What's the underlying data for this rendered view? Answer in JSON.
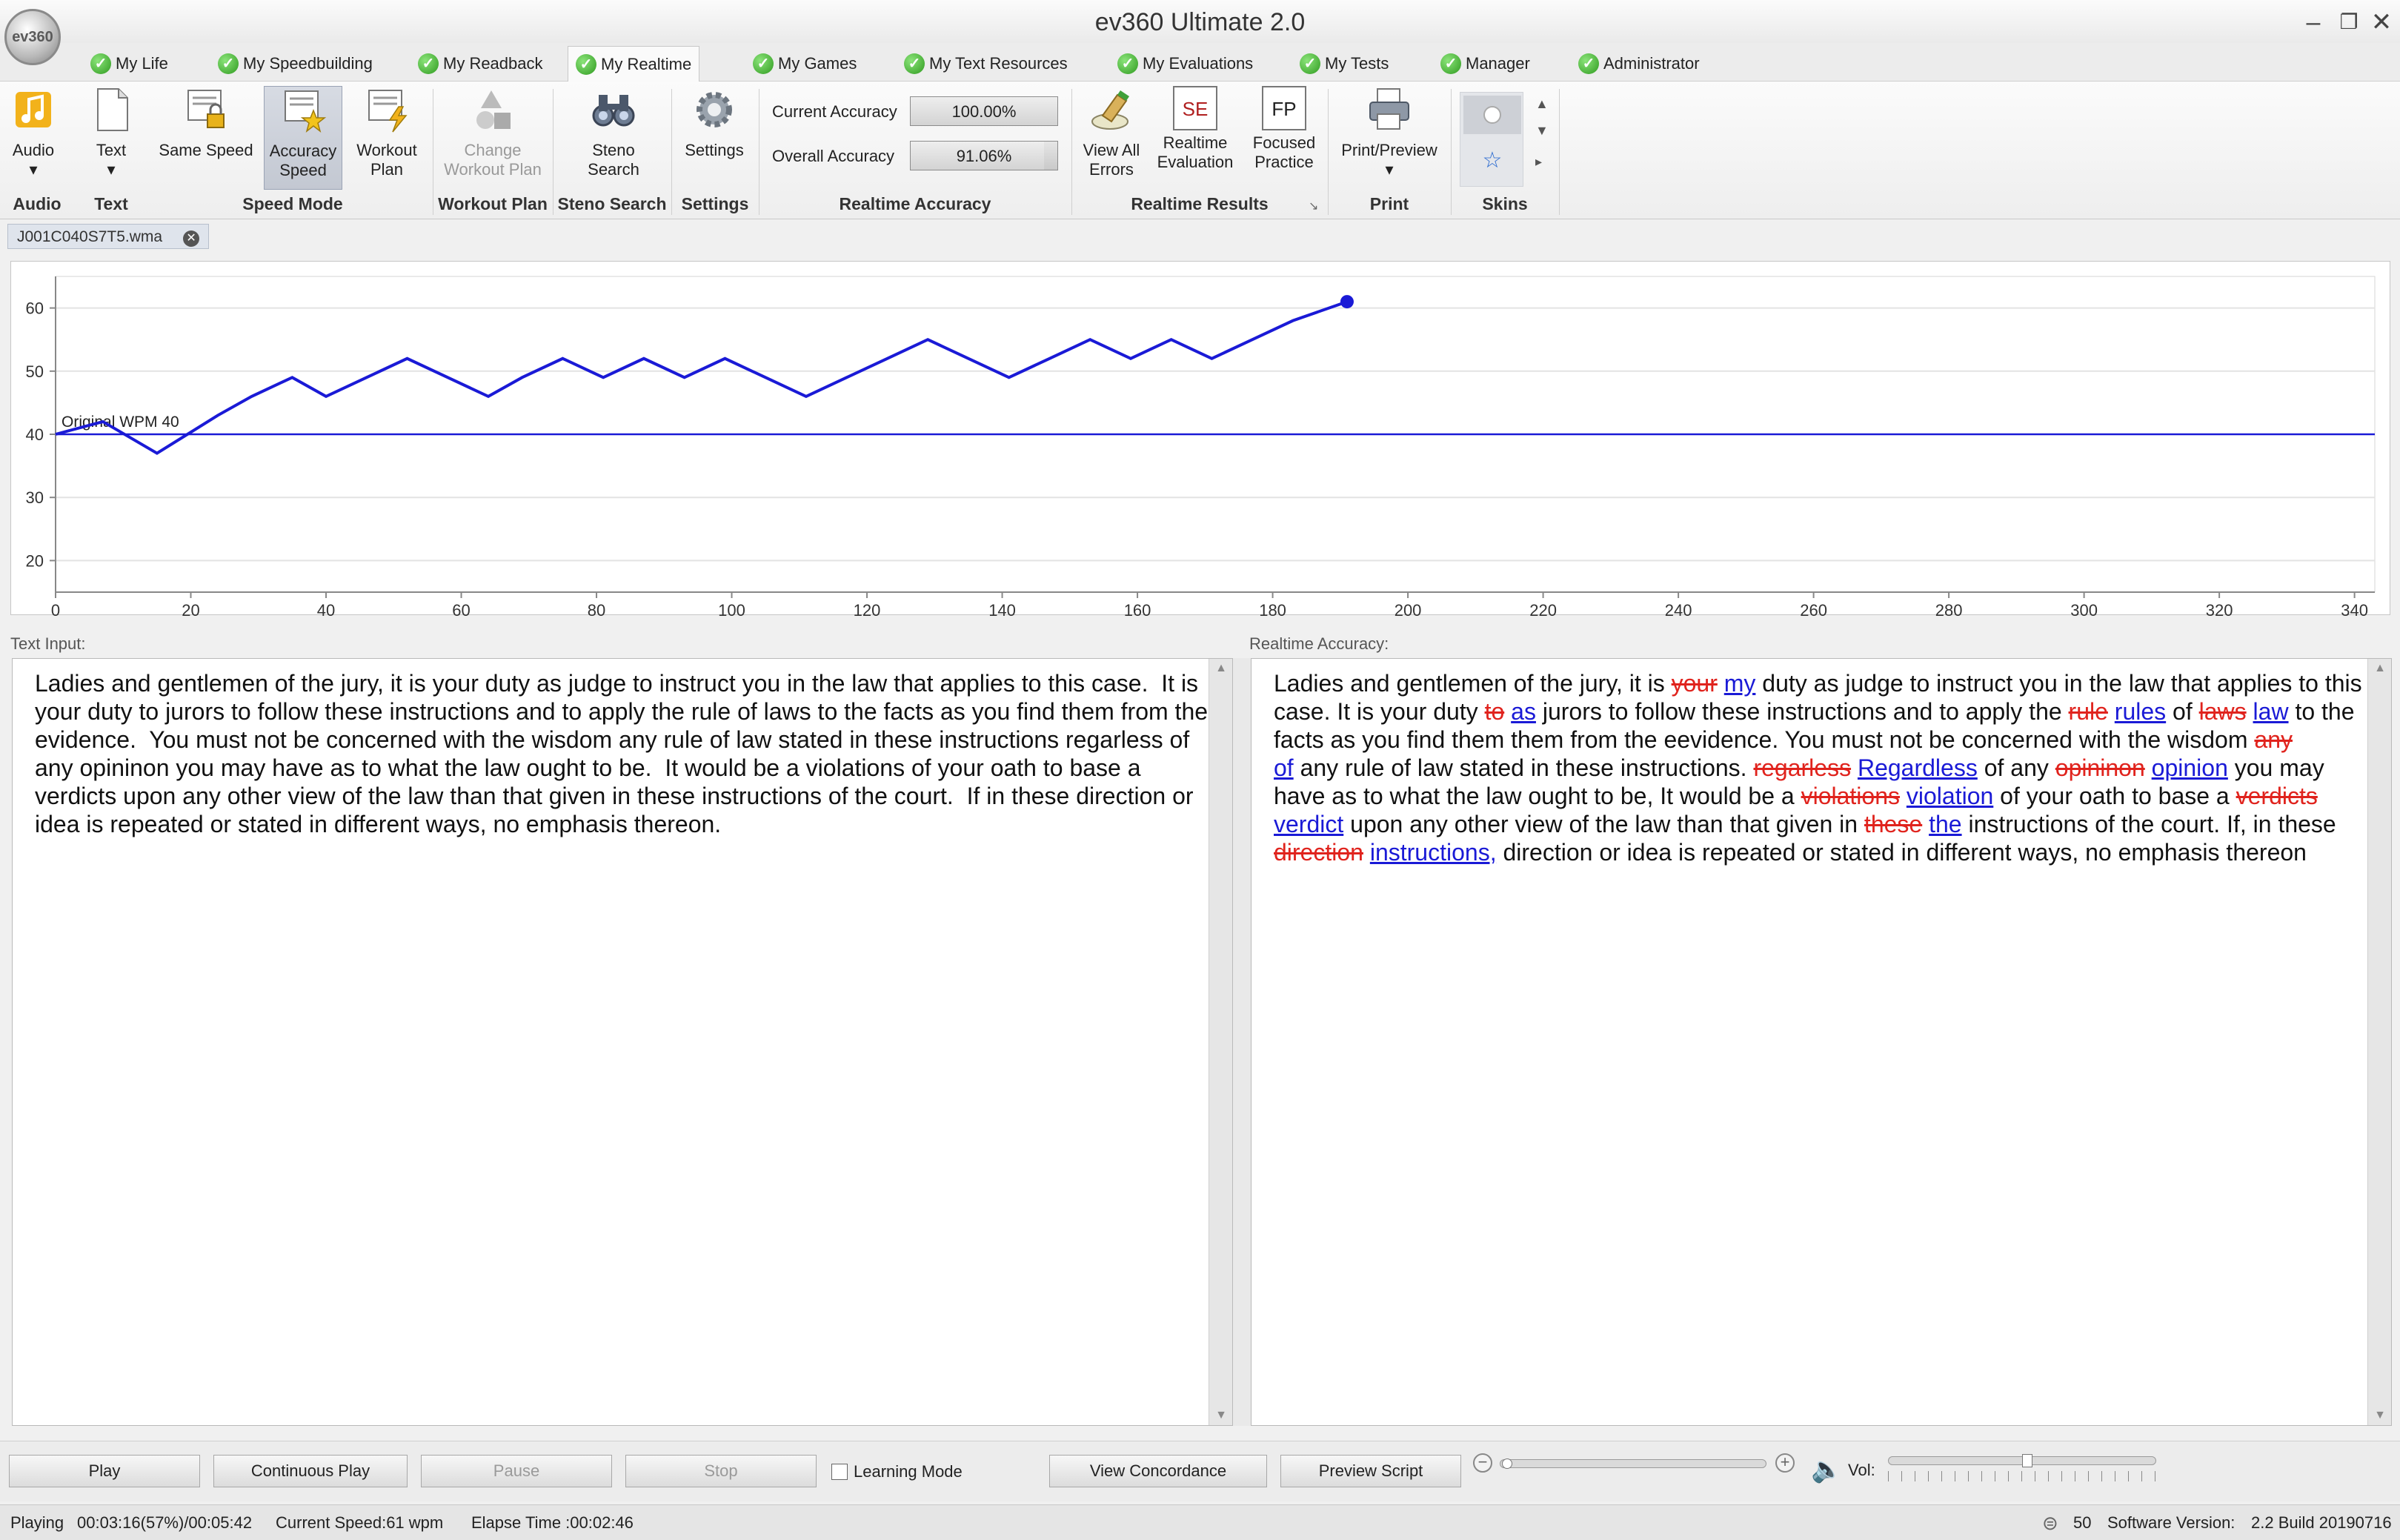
{
  "window": {
    "title": "ev360 Ultimate 2.0",
    "logo": "ev360"
  },
  "tabs": [
    {
      "label": "My Life"
    },
    {
      "label": "My Speedbuilding"
    },
    {
      "label": "My Readback"
    },
    {
      "label": "My Realtime"
    },
    {
      "label": "My Games"
    },
    {
      "label": "My Text Resources"
    },
    {
      "label": "My Evaluations"
    },
    {
      "label": "My Tests"
    },
    {
      "label": "Manager"
    },
    {
      "label": "Administrator"
    }
  ],
  "ribbon": {
    "audio": "Audio",
    "text": "Text",
    "same_speed": "Same Speed",
    "accuracy_speed_1": "Accuracy",
    "accuracy_speed_2": "Speed",
    "workout_plan_1": "Workout",
    "workout_plan_2": "Plan",
    "change_workout_1": "Change",
    "change_workout_2": "Workout Plan",
    "steno_search_1": "Steno",
    "steno_search_2": "Search",
    "settings": "Settings",
    "current_accuracy_label": "Current Accuracy",
    "current_accuracy_value": "100.00%",
    "current_accuracy_fraction": 1.0,
    "overall_accuracy_label": "Overall Accuracy",
    "overall_accuracy_value": "91.06%",
    "overall_accuracy_fraction": 0.9106,
    "view_errors_1": "View All",
    "view_errors_2": "Errors",
    "realtime_eval_1": "Realtime",
    "realtime_eval_2": "Evaluation",
    "focused_1": "Focused",
    "focused_2": "Practice",
    "se_icon_text": "SE",
    "fp_icon_text": "FP",
    "print_preview": "Print/Preview",
    "groups": {
      "audio": "Audio",
      "text": "Text",
      "speed_mode": "Speed Mode",
      "workout_plan": "Workout Plan",
      "steno_search": "Steno Search",
      "settings": "Settings",
      "realtime_accuracy": "Realtime Accuracy",
      "realtime_results": "Realtime Results",
      "print": "Print",
      "skins": "Skins"
    }
  },
  "document_tab": {
    "name": "J001C040S7T5.wma"
  },
  "chart_data": {
    "type": "line",
    "xlim": [
      0,
      343
    ],
    "ylim": [
      15,
      65
    ],
    "x_ticks": [
      0,
      20,
      40,
      60,
      80,
      100,
      120,
      140,
      160,
      180,
      200,
      220,
      240,
      260,
      280,
      300,
      320,
      340
    ],
    "y_ticks": [
      20,
      30,
      40,
      50,
      60
    ],
    "grid": true,
    "reference_line": {
      "y": 40,
      "label": "Original WPM 40"
    },
    "series": [
      {
        "x": [
          0,
          7,
          15,
          24,
          29,
          35,
          40,
          46,
          52,
          64,
          69,
          75,
          81,
          87,
          93,
          99,
          111,
          117,
          123,
          129,
          141,
          147,
          153,
          159,
          165,
          171,
          177,
          183,
          191
        ],
        "y": [
          40,
          42,
          37,
          43,
          46,
          49,
          46,
          49,
          52,
          46,
          49,
          52,
          49,
          52,
          49,
          52,
          46,
          49,
          52,
          55,
          49,
          52,
          55,
          52,
          55,
          52,
          55,
          58,
          61
        ]
      }
    ]
  },
  "text_input": {
    "label": "Text Input:",
    "lines": [
      "Ladies and gentlemen of the jury, it is your duty as judge to instruct you in the law that applies to this case.  It is",
      "your duty to jurors to follow these instructions and to apply the rule of laws to the facts as you find them from the",
      "evidence.  You must not be concerned with the wisdom any rule of law stated in these instructions regarless of",
      "any opininon you may have as to what the law ought to be.  It would be a violations of your oath to base a",
      "verdicts upon any other view of the law than that given in these instructions of the court.  If in these direction or",
      "idea is repeated or stated in different ways, no emphasis thereon."
    ]
  },
  "realtime_accuracy": {
    "label": "Realtime Accuracy:",
    "lines": [
      [
        {
          "t": "Ladies and gentlemen of the jury, it is "
        },
        {
          "t": "your",
          "s": "del"
        },
        {
          "t": " "
        },
        {
          "t": "my",
          "s": "ins"
        },
        {
          "t": " duty as judge to instruct you in the law that applies to this"
        }
      ],
      [
        {
          "t": "case. It is your duty "
        },
        {
          "t": "to",
          "s": "del"
        },
        {
          "t": " "
        },
        {
          "t": "as",
          "s": "ins"
        },
        {
          "t": " jurors to follow these instructions and to apply the "
        },
        {
          "t": "rule",
          "s": "del"
        },
        {
          "t": " "
        },
        {
          "t": "rules",
          "s": "ins"
        },
        {
          "t": " of "
        },
        {
          "t": "laws",
          "s": "del"
        },
        {
          "t": " "
        },
        {
          "t": "law",
          "s": "ins"
        },
        {
          "t": " to the"
        }
      ],
      [
        {
          "t": "facts as you find them them from the eevidence. You must not be concerned with the wisdom "
        },
        {
          "t": "any",
          "s": "del"
        }
      ],
      [
        {
          "t": "of",
          "s": "ins"
        },
        {
          "t": " any rule of law stated in these instructions. "
        },
        {
          "t": "regarless",
          "s": "del"
        },
        {
          "t": " "
        },
        {
          "t": "Regardless",
          "s": "ins"
        },
        {
          "t": " of any "
        },
        {
          "t": "opininon",
          "s": "del"
        },
        {
          "t": " "
        },
        {
          "t": "opinion",
          "s": "ins"
        },
        {
          "t": " you may"
        }
      ],
      [
        {
          "t": "have as to what the law ought to be, It would be a "
        },
        {
          "t": "violations",
          "s": "del"
        },
        {
          "t": " "
        },
        {
          "t": "violation",
          "s": "ins"
        },
        {
          "t": " of your oath to base a "
        },
        {
          "t": "verdicts",
          "s": "del"
        }
      ],
      [
        {
          "t": "verdict",
          "s": "ins"
        },
        {
          "t": " upon any other view of the law than that given in "
        },
        {
          "t": "these",
          "s": "del"
        },
        {
          "t": " "
        },
        {
          "t": "the",
          "s": "ins"
        },
        {
          "t": " instructions of the court. If, in these"
        }
      ],
      [
        {
          "t": "direction",
          "s": "del"
        },
        {
          "t": " "
        },
        {
          "t": "instructions,",
          "s": "ins"
        },
        {
          "t": " direction or idea is repeated or stated in different ways, no emphasis thereon"
        }
      ]
    ]
  },
  "controls": {
    "play": "Play",
    "continuous_play": "Continuous Play",
    "pause": "Pause",
    "stop": "Stop",
    "learning_mode": "Learning Mode",
    "view_concordance": "View Concordance",
    "preview_script": "Preview  Script",
    "vol_label": "Vol:",
    "volume_fraction": 0.5
  },
  "status": {
    "state": "Playing",
    "time": "00:03:16(57%)/00:05:42",
    "speed": "Current Speed:61 wpm",
    "elapsed": "Elapse Time :00:02:46",
    "count": "50",
    "version_label": "Software Version:",
    "version": "2.2 Build 20190716"
  }
}
